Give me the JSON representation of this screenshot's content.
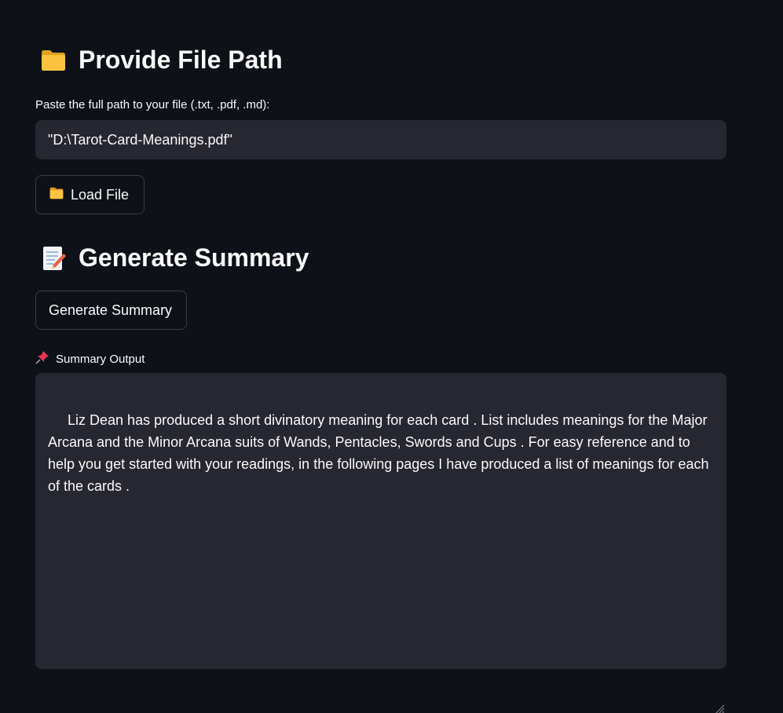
{
  "file_section": {
    "icon": "folder-icon",
    "title": "Provide File Path",
    "input_label": "Paste the full path to your file (.txt, .pdf, .md):",
    "input_value": "\"D:\\Tarot-Card-Meanings.pdf\"",
    "load_button": {
      "icon": "folder-icon",
      "label": "Load File"
    }
  },
  "summary_section": {
    "icon": "memo-icon",
    "title": "Generate Summary",
    "generate_button": "Generate Summary",
    "output_label_icon": "pushpin-icon",
    "output_label": "Summary Output",
    "output_text": " Liz Dean has produced a short divinatory meaning for each card . List includes meanings for the Major Arcana and the Minor Arcana suits of Wands, Pentacles, Swords and Cups . For easy reference and to help you get started with your readings, in the following pages I have produced a list of meanings for each of the cards ."
  },
  "colors": {
    "background": "#0e1117",
    "input_bg": "#262730",
    "text": "#fafafa",
    "folder": "#f7b731",
    "pin": "#e8385a"
  }
}
